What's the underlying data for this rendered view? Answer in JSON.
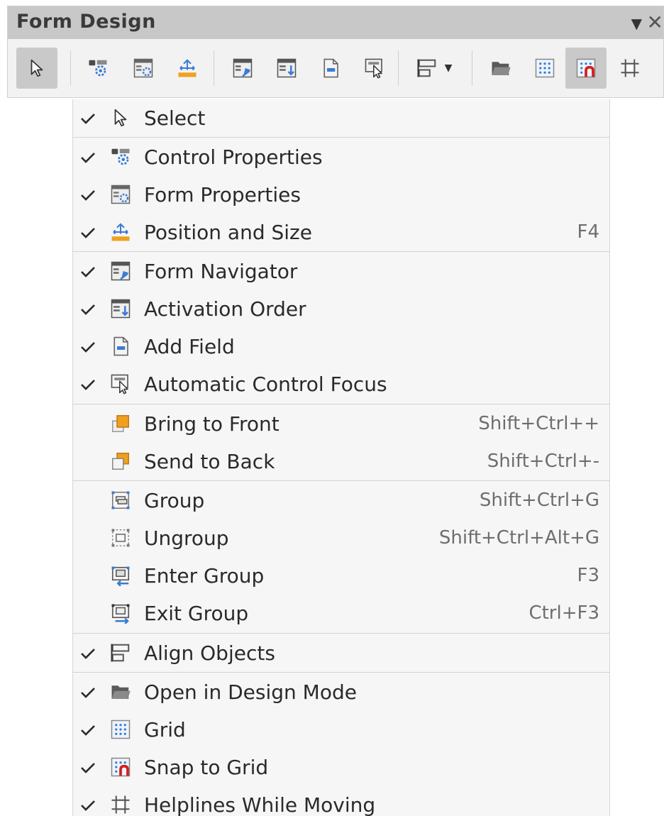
{
  "toolbar": {
    "title": "Form Design",
    "dropdown_glyph": "▼",
    "close_glyph": "✕",
    "buttons": [
      {
        "name": "select-tool-button",
        "icon": "pointer-icon",
        "active": true
      },
      {
        "name": "control-properties-button",
        "icon": "control-properties-icon"
      },
      {
        "name": "form-properties-button",
        "icon": "form-properties-icon"
      },
      {
        "name": "position-size-button",
        "icon": "position-size-icon"
      },
      {
        "name": "form-navigator-button",
        "icon": "form-navigator-icon"
      },
      {
        "name": "activation-order-button",
        "icon": "activation-order-icon"
      },
      {
        "name": "add-field-button",
        "icon": "add-field-icon"
      },
      {
        "name": "auto-focus-button",
        "icon": "auto-focus-icon"
      },
      {
        "name": "align-objects-button",
        "icon": "align-objects-icon"
      },
      {
        "name": "open-design-mode-button",
        "icon": "folder-icon"
      },
      {
        "name": "grid-button",
        "icon": "grid-icon"
      },
      {
        "name": "snap-to-grid-button",
        "icon": "snap-grid-icon",
        "active": true
      },
      {
        "name": "helplines-button",
        "icon": "helplines-icon"
      }
    ]
  },
  "menu": {
    "items": [
      {
        "label": "Select",
        "shortcut": "",
        "checked": true,
        "icon": "pointer-icon"
      },
      {
        "label": "Control Properties",
        "shortcut": "",
        "checked": true,
        "icon": "control-properties-icon"
      },
      {
        "label": "Form Properties",
        "shortcut": "",
        "checked": true,
        "icon": "form-properties-icon"
      },
      {
        "label": "Position and Size",
        "shortcut": "F4",
        "checked": true,
        "icon": "position-size-icon"
      },
      {
        "label": "Form Navigator",
        "shortcut": "",
        "checked": true,
        "icon": "form-navigator-icon"
      },
      {
        "label": "Activation Order",
        "shortcut": "",
        "checked": true,
        "icon": "activation-order-icon"
      },
      {
        "label": "Add Field",
        "shortcut": "",
        "checked": true,
        "icon": "add-field-icon"
      },
      {
        "label": "Automatic Control Focus",
        "shortcut": "",
        "checked": true,
        "icon": "auto-focus-icon"
      },
      {
        "label": "Bring to Front",
        "shortcut": "Shift+Ctrl++",
        "checked": false,
        "icon": "bring-front-icon"
      },
      {
        "label": "Send to Back",
        "shortcut": "Shift+Ctrl+-",
        "checked": false,
        "icon": "send-back-icon"
      },
      {
        "label": "Group",
        "shortcut": "Shift+Ctrl+G",
        "checked": false,
        "icon": "group-icon"
      },
      {
        "label": "Ungroup",
        "shortcut": "Shift+Ctrl+Alt+G",
        "checked": false,
        "icon": "ungroup-icon"
      },
      {
        "label": "Enter Group",
        "shortcut": "F3",
        "checked": false,
        "icon": "enter-group-icon"
      },
      {
        "label": "Exit Group",
        "shortcut": "Ctrl+F3",
        "checked": false,
        "icon": "exit-group-icon"
      },
      {
        "label": "Align Objects",
        "shortcut": "",
        "checked": true,
        "icon": "align-objects-icon"
      },
      {
        "label": "Open in Design Mode",
        "shortcut": "",
        "checked": true,
        "icon": "folder-icon"
      },
      {
        "label": "Grid",
        "shortcut": "",
        "checked": true,
        "icon": "grid-icon"
      },
      {
        "label": "Snap to Grid",
        "shortcut": "",
        "checked": true,
        "icon": "snap-grid-icon"
      },
      {
        "label": "Helplines While Moving",
        "shortcut": "",
        "checked": true,
        "icon": "helplines-icon"
      }
    ]
  },
  "colors": {
    "menu_bg": "#f6f6f6",
    "toolbar_bg": "#f2f2f2",
    "title_bg": "#c8c8c8",
    "icon_blue": "#3a7bd5",
    "icon_orange": "#f0a020",
    "icon_red": "#d32020",
    "text": "#2a2a2a",
    "shortcut_text": "#6e6e6e"
  }
}
